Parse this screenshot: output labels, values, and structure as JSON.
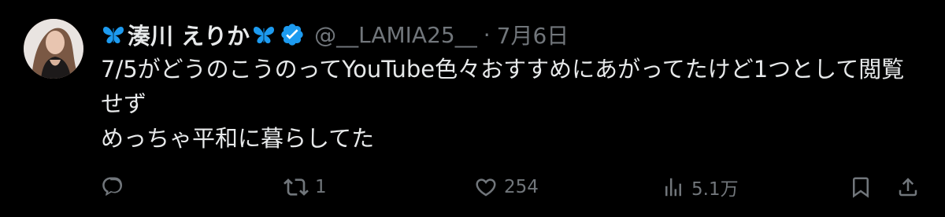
{
  "tweet": {
    "author": {
      "display_name": "湊川 えりか",
      "handle": "@__LAMIA25__",
      "verified_icon": "verified-badge-icon",
      "name_prefix_icon": "butterfly-icon",
      "name_suffix_icon": "butterfly-icon"
    },
    "separator": "·",
    "date": "7月6日",
    "body": {
      "line1": "7/5がどうのこうのってYouTube色々おすすめにあがってたけど1つとして閲覧せず",
      "line2": "めっちゃ平和に暮らしてた"
    },
    "actions": {
      "reply": {
        "icon": "reply-icon",
        "count": ""
      },
      "retweet": {
        "icon": "retweet-icon",
        "count": "1"
      },
      "like": {
        "icon": "heart-icon",
        "count": "254"
      },
      "views": {
        "icon": "views-chart-icon",
        "count": "5.1万"
      },
      "bookmark": {
        "icon": "bookmark-icon"
      },
      "share": {
        "icon": "share-icon"
      }
    },
    "colors": {
      "background": "#000000",
      "text_primary": "#e7e9ea",
      "text_secondary": "#71767b",
      "verified": "#1d9bf0",
      "butterfly": "#1d9bf0"
    }
  }
}
